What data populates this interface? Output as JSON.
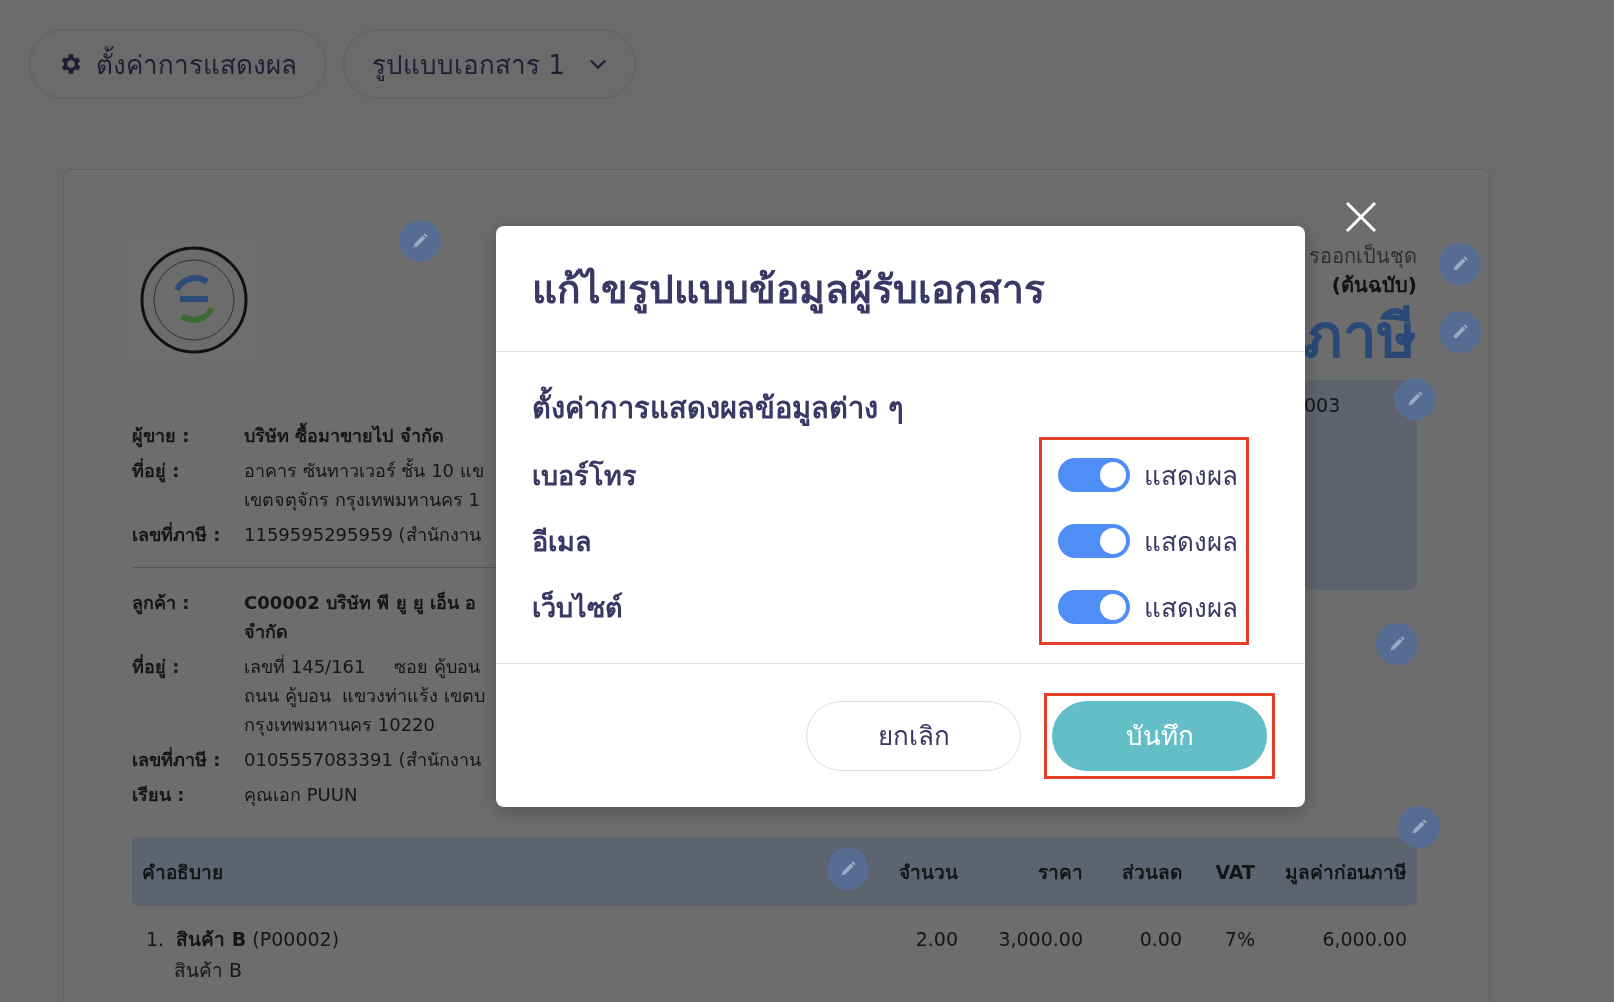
{
  "toolbar": {
    "display_settings": "ตั้งค่าการแสดงผล",
    "template_select": "รูปแบบเอกสาร 1"
  },
  "document": {
    "copy_note": "รออกเป็นชุด",
    "copy_label": "(ต้นฉบับ)",
    "title": "ภาษี",
    "number_fragment": "003",
    "seller": [
      {
        "label": "ผู้ขาย :",
        "lines": [
          "บริษัท ซื้อมาขายไป จำกัด"
        ],
        "bold": true
      },
      {
        "label": "ที่อยู่ :",
        "lines": [
          "อาคาร ซันทาวเวอร์ ชั้น 10 แข",
          "เขตจตุจักร กรุงเทพมหานคร 1"
        ],
        "bold": false
      },
      {
        "label": "เลขที่ภาษี :",
        "lines": [
          "1159595295959 (สำนักงาน"
        ],
        "bold": false
      }
    ],
    "customer": [
      {
        "label": "ลูกค้า :",
        "lines": [
          "C00002 บริษัท พี ยู ยู เอ็น อ",
          "จำกัด"
        ],
        "bold": true
      },
      {
        "label": "ที่อยู่ :",
        "lines": [
          "เลขที่ 145/161     ซอย คู้บอน",
          "ถนน คู้บอน  แขวงท่าแร้ง เขตบ",
          "กรุงเทพมหานคร 10220"
        ],
        "bold": false
      },
      {
        "label": "เลขที่ภาษี :",
        "lines": [
          "0105557083391 (สำนักงาน"
        ],
        "bold": false
      },
      {
        "label": "เรียน :",
        "lines": [
          "คุณเอก PUUN"
        ],
        "bold": false
      }
    ],
    "table": {
      "columns": [
        "คำอธิบาย",
        "จำนวน",
        "ราคา",
        "ส่วนลด",
        "VAT",
        "มูลค่าก่อนภาษี"
      ],
      "rows": [
        {
          "detail": "สินค้า B",
          "cells": [
            "1.  **สินค้า B** (P00002)",
            "2.00",
            "3,000.00",
            "0.00",
            "7%",
            "6,000.00"
          ]
        }
      ]
    }
  },
  "dialog": {
    "title": "แก้ไขรูปแบบข้อมูลผู้รับเอกสาร",
    "section": "ตั้งค่าการแสดงผลข้อมูลต่าง ๆ",
    "toggles_highlighted": true,
    "rows": [
      {
        "label": "เบอร์โทร",
        "on": true,
        "state_label": "แสดงผล"
      },
      {
        "label": "อีเมล",
        "on": true,
        "state_label": "แสดงผล"
      },
      {
        "label": "เว็บไซต์",
        "on": true,
        "state_label": "แสดงผล"
      }
    ],
    "buttons": [
      {
        "label": "ยกเลิก",
        "kind": "secondary",
        "highlighted": false
      },
      {
        "label": "บันทึก",
        "kind": "primary",
        "highlighted": true
      }
    ]
  }
}
